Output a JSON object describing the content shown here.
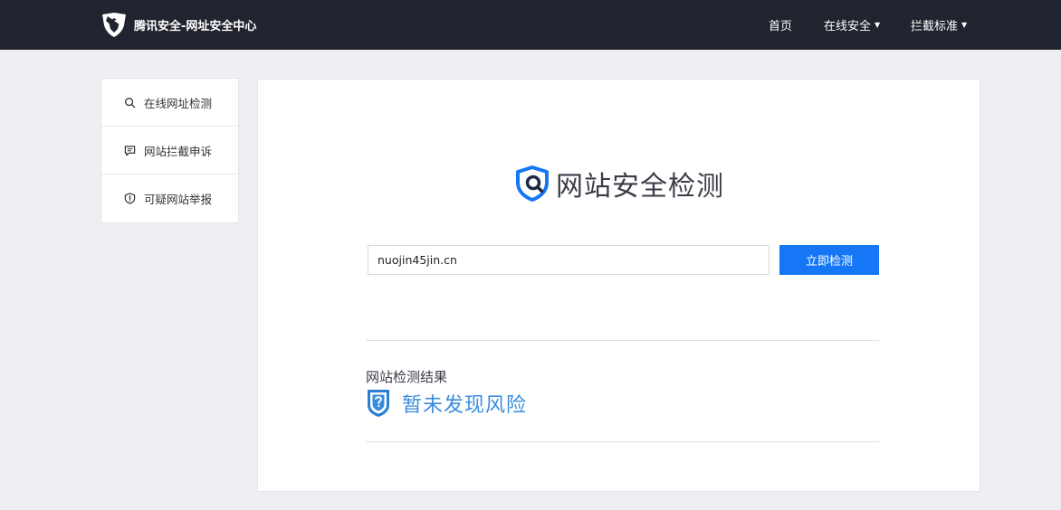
{
  "header": {
    "brand_title": "腾讯安全-网址安全中心",
    "nav": {
      "home": "首页",
      "online_security": "在线安全",
      "block_standard": "拦截标准",
      "caret": "▼"
    }
  },
  "sidebar": {
    "items": [
      {
        "label": "在线网址检测",
        "icon": "search-icon"
      },
      {
        "label": "网站拦截申诉",
        "icon": "comment-icon"
      },
      {
        "label": "可疑网站举报",
        "icon": "alert-shield-icon"
      }
    ]
  },
  "main": {
    "hero_title": "网站安全检测",
    "url_input": {
      "value": "nuojin45jin.cn",
      "placeholder": ""
    },
    "check_button": "立即检测",
    "result": {
      "label": "网站检测结果",
      "status": "暂未发现风险",
      "status_icon": "unknown-shield-icon"
    }
  },
  "colors": {
    "topbar": "#21232e",
    "accent": "#1577f5",
    "result_text": "#3a8dde",
    "page_bg": "#efeff3"
  }
}
